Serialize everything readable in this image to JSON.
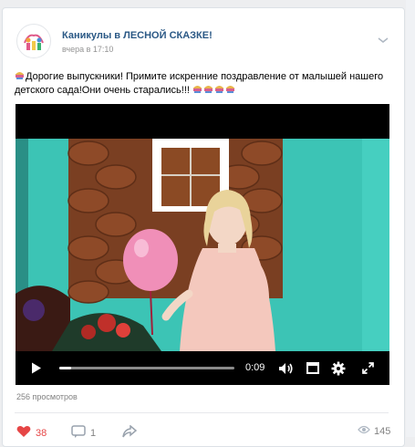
{
  "post": {
    "group_name": "Каникулы в ЛЕСНОЙ СКАЗКЕ!",
    "time": "вчера в 17:10",
    "text_line1": "Дорогие выпускники! Примите искренние поздравление от малышей нашего",
    "text_line2": "детского сада!Они очень старались!!!",
    "emoji_icon": "graduation-cap-icon"
  },
  "video": {
    "time": "0:09",
    "progress": 0.07,
    "controls": [
      "play-icon",
      "volume-icon",
      "fullscreen-window-icon",
      "settings-icon",
      "expand-icon"
    ]
  },
  "footer": {
    "views": "256 просмотров",
    "likes": "38",
    "comments": "1",
    "views_count": "145"
  },
  "colors": {
    "link": "#2a5885",
    "like": "#e64646",
    "muted": "#828282",
    "wall": "#3cc4b5"
  }
}
